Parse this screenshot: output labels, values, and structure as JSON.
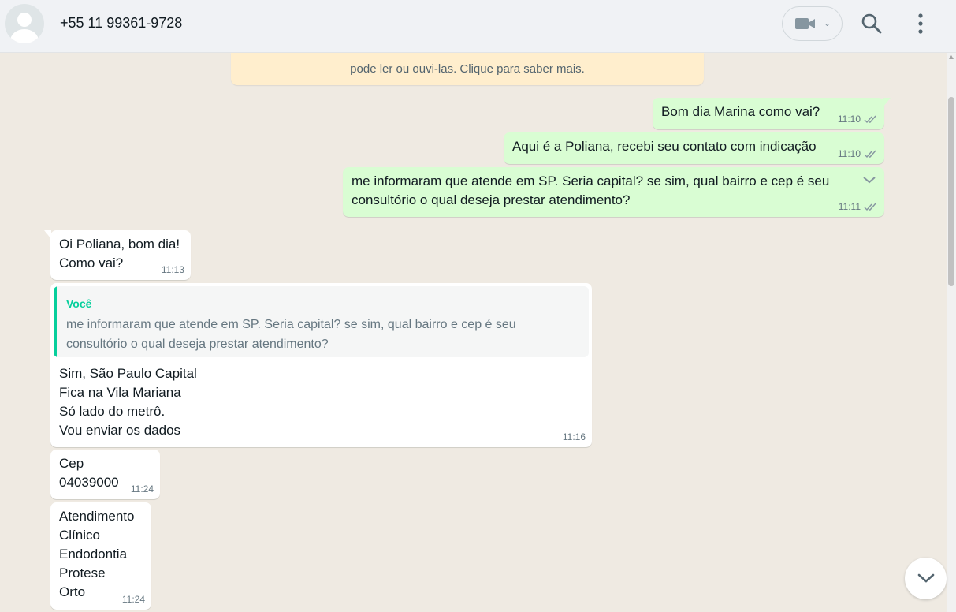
{
  "header": {
    "contact_name": "+55 11 99361-9728",
    "icons": [
      "avatar",
      "video-call-icon",
      "chevron-down-icon",
      "search-icon",
      "menu-icon"
    ]
  },
  "banner": {
    "text": "pode ler ou ouvi-las. Clique para saber mais."
  },
  "messages": [
    {
      "direction": "out",
      "text": "Bom dia Marina como vai?",
      "time": "11:10",
      "status": "read"
    },
    {
      "direction": "out",
      "text": "Aqui é a Poliana, recebi seu contato com indicação",
      "time": "11:10",
      "status": "read"
    },
    {
      "direction": "out",
      "text": "me informaram que atende em SP. Seria capital? se sim, qual bairro e cep é seu\nconsultório o qual deseja prestar atendimento?",
      "time": "11:11",
      "status": "read"
    },
    {
      "direction": "in",
      "text": "Oi Poliana, bom dia!\nComo vai?",
      "time": "11:13"
    },
    {
      "direction": "in",
      "quote_author": "Você",
      "quote_text": "me informaram que atende em SP. Seria capital? se sim, qual bairro e cep é seu\nconsultório o qual deseja prestar atendimento?",
      "text": "Sim, São Paulo Capital\nFica na Vila Mariana\nSó lado do metrô.\nVou enviar os dados",
      "time": "11:16"
    },
    {
      "direction": "in",
      "text": "Cep\n04039000",
      "time": "11:24"
    },
    {
      "direction": "in",
      "text": "Atendimento\nClínico\nEndodontia\nProtese\nOrto",
      "time": "11:24"
    }
  ],
  "colors": {
    "outgoing_bubble": "#d9fdd3",
    "incoming_bubble": "#ffffff",
    "chat_background": "#efeae2",
    "read_ticks": "#8696a0",
    "quote_accent": "#06cf9c",
    "banner": "#ffeecd"
  }
}
